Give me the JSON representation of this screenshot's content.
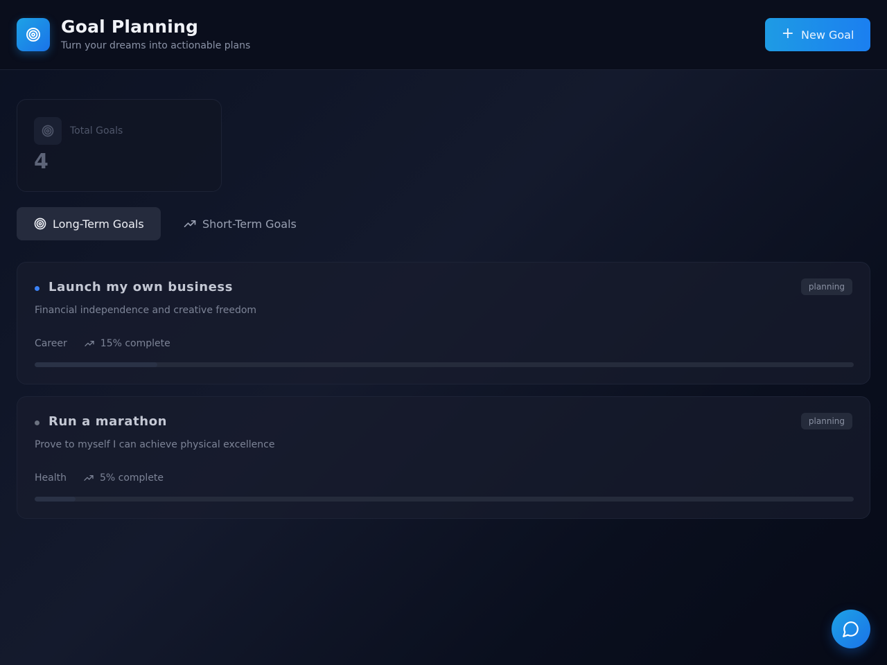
{
  "header": {
    "logo_icon": "target-icon",
    "title": "Goal Planning",
    "subtitle": "Turn your dreams into actionable plans",
    "new_goal_label": "New Goal",
    "new_goal_icon": "plus-icon"
  },
  "stats": {
    "icon": "target-icon",
    "label": "Total Goals",
    "value": "4"
  },
  "tabs": [
    {
      "label": "Long-Term Goals",
      "icon": "target-icon",
      "active": true
    },
    {
      "label": "Short-Term Goals",
      "icon": "trending-up-icon",
      "active": false
    }
  ],
  "goals": [
    {
      "title": "Launch my own business",
      "description": "Financial independence and creative freedom",
      "status": "planning",
      "category": "Career",
      "progress_text": "15% complete",
      "progress": 0.15,
      "dot_color": "#3b82f6"
    },
    {
      "title": "Run a marathon",
      "description": "Prove to myself I can achieve physical excellence",
      "status": "planning",
      "category": "Health",
      "progress_text": "5% complete",
      "progress": 0.05,
      "dot_color": "#6b7280"
    }
  ],
  "chat_button_icon": "chat-bubble-icon",
  "colors": {
    "accent": "#1b7ff0",
    "background": "#0b1122"
  }
}
